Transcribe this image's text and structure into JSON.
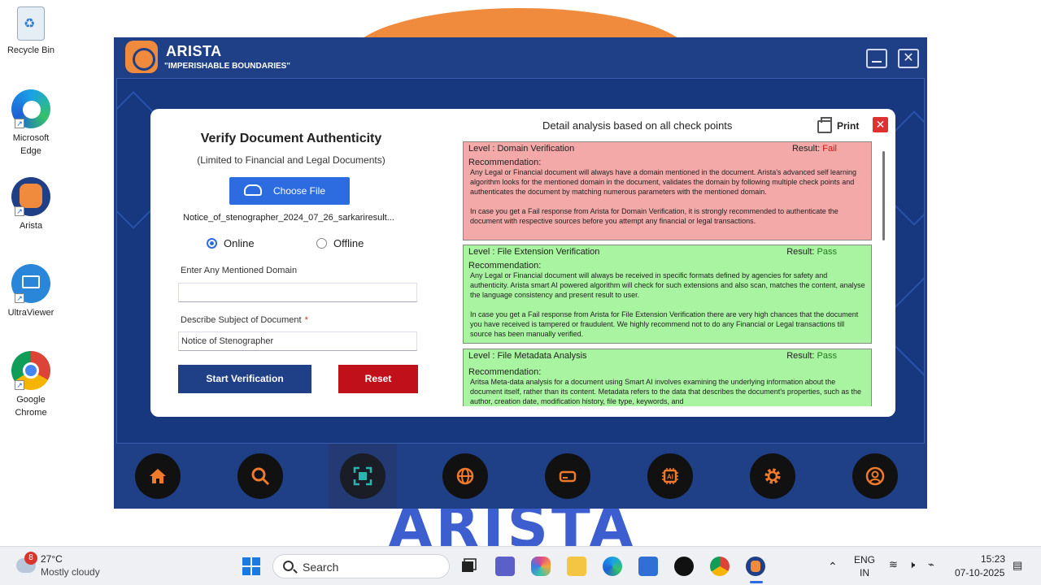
{
  "desktop": {
    "icons": [
      {
        "label": "Recycle Bin"
      },
      {
        "label": "Microsoft Edge"
      },
      {
        "label": "Arista"
      },
      {
        "label": "UltraViewer"
      },
      {
        "label": "Google Chrome"
      }
    ],
    "background_wordmark": "ARISTA"
  },
  "window": {
    "app_name": "ARISTA",
    "tagline": "\"IMPERISHABLE BOUNDARIES\"",
    "close_glyph": "✕"
  },
  "form": {
    "title": "Verify Document Authenticity",
    "subtitle": "(Limited to Financial and Legal Documents)",
    "choose_file_label": "Choose File",
    "file_name": "Notice_of_stenographer_2024_07_26_sarkariresult...",
    "mode_options": [
      {
        "label": "Online",
        "selected": true
      },
      {
        "label": "Offline",
        "selected": false
      }
    ],
    "domain_label": "Enter Any Mentioned Domain",
    "domain_value": "",
    "subject_label": "Describe Subject of Document",
    "subject_required_mark": "*",
    "subject_value": "Notice of Stenographer",
    "start_label": "Start Verification",
    "reset_label": "Reset"
  },
  "analysis": {
    "title": "Detail analysis based on all check points",
    "print_label": "Print",
    "close_glyph": "✕",
    "results": [
      {
        "level": "Level : Domain Verification",
        "result_label": "Result:",
        "result": "Fail",
        "status": "fail",
        "recommendation_label": "Recommendation:",
        "text": "Any Legal or Financial document will always have a domain mentioned in the document. Arista's advanced self learning algorithm looks for the mentioned domain in the document, validates the domain by following multiple check points and authenticates the document by matching numerous parameters with the mentioned domain.",
        "text2": "In case you get a Fail response from Arista for Domain Verification, it is strongly recommended to authenticate the document with respective sources before you attempt any financial or legal transactions."
      },
      {
        "level": "Level : File Extension Verification",
        "result_label": "Result:",
        "result": "Pass",
        "status": "pass",
        "recommendation_label": "Recommendation:",
        "text": "Any Legal or Financial document will always be received in specific formats defined by agencies for safety and authenticity. Arista smart AI powered algorithm will check for such extensions and also scan, matches the content, analyse the language consistency and present result to user.",
        "text2": "In case you get a Fail response from Arista for File Extension Verification there are very high chances that the document you have received is tampered or fraudulent. We highly recommend not to do any Financial or Legal transactions till source has been manually verified."
      },
      {
        "level": "Level : File Metadata Analysis",
        "result_label": "Result:",
        "result": "Pass",
        "status": "pass",
        "recommendation_label": "Recommendation:",
        "text": "Aritsa Meta-data analysis for a document using Smart AI involves examining the underlying information about the document itself, rather than its content. Metadata refers to the data that describes the document's properties, such as the author, creation date, modification history, file type, keywords, and",
        "text2": ""
      }
    ]
  },
  "dock": {
    "items": [
      {
        "icon": "home-icon"
      },
      {
        "icon": "search-icon"
      },
      {
        "icon": "scan-icon"
      },
      {
        "icon": "network-icon"
      },
      {
        "icon": "drive-icon"
      },
      {
        "icon": "ai-chip-icon"
      },
      {
        "icon": "gear-icon"
      },
      {
        "icon": "user-icon"
      }
    ],
    "accent": "#f07a2a"
  },
  "taskbar": {
    "weather_badge": "8",
    "temperature": "27°C",
    "condition": "Mostly cloudy",
    "search_placeholder": "Search",
    "language_line1": "ENG",
    "language_line2": "IN",
    "time": "15:23",
    "date": "07-10-2025"
  }
}
